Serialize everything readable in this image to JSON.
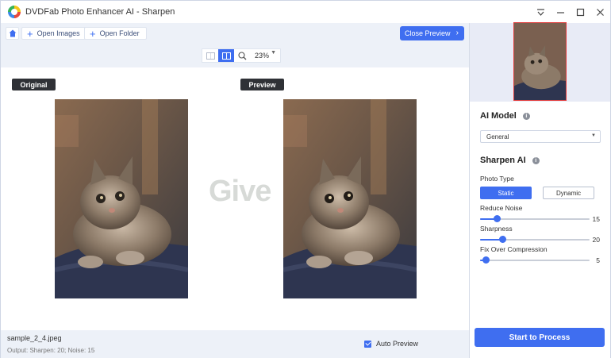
{
  "window": {
    "title": "DVDFab Photo Enhancer AI - Sharpen",
    "controls": [
      "dropdown-icon",
      "minimize-icon",
      "maximize-icon",
      "close-icon"
    ]
  },
  "toolbar": {
    "open_images": "Open Images",
    "open_folder": "Open Folder",
    "close_preview": "Close Preview"
  },
  "viewbar": {
    "zoom": "23%"
  },
  "canvas": {
    "original_label": "Original",
    "preview_label": "Preview",
    "watermark": "Give"
  },
  "bottom": {
    "filename": "sample_2_4.jpeg",
    "output": "Output: Sharpen: 20; Noise: 15",
    "auto_preview": "Auto Preview",
    "auto_preview_checked": true
  },
  "panel": {
    "ai_model_title": "AI Model",
    "ai_model_value": "General",
    "sharpen_title": "Sharpen AI",
    "photo_type_label": "Photo Type",
    "photo_type_options": [
      "Static",
      "Dynamic"
    ],
    "photo_type_selected": "Static",
    "sliders": [
      {
        "label": "Reduce Noise",
        "value": "15",
        "fraction": 0.15
      },
      {
        "label": "Sharpness",
        "value": "20",
        "fraction": 0.2
      },
      {
        "label": "Fix Over Compression",
        "value": "5",
        "fraction": 0.05
      }
    ],
    "start_button": "Start to Process"
  },
  "colors": {
    "accent": "#3f6ef0",
    "toolbar_bg": "#edf1f8",
    "tag_bg": "#2f3136",
    "thumb_border": "#e23c3c"
  }
}
